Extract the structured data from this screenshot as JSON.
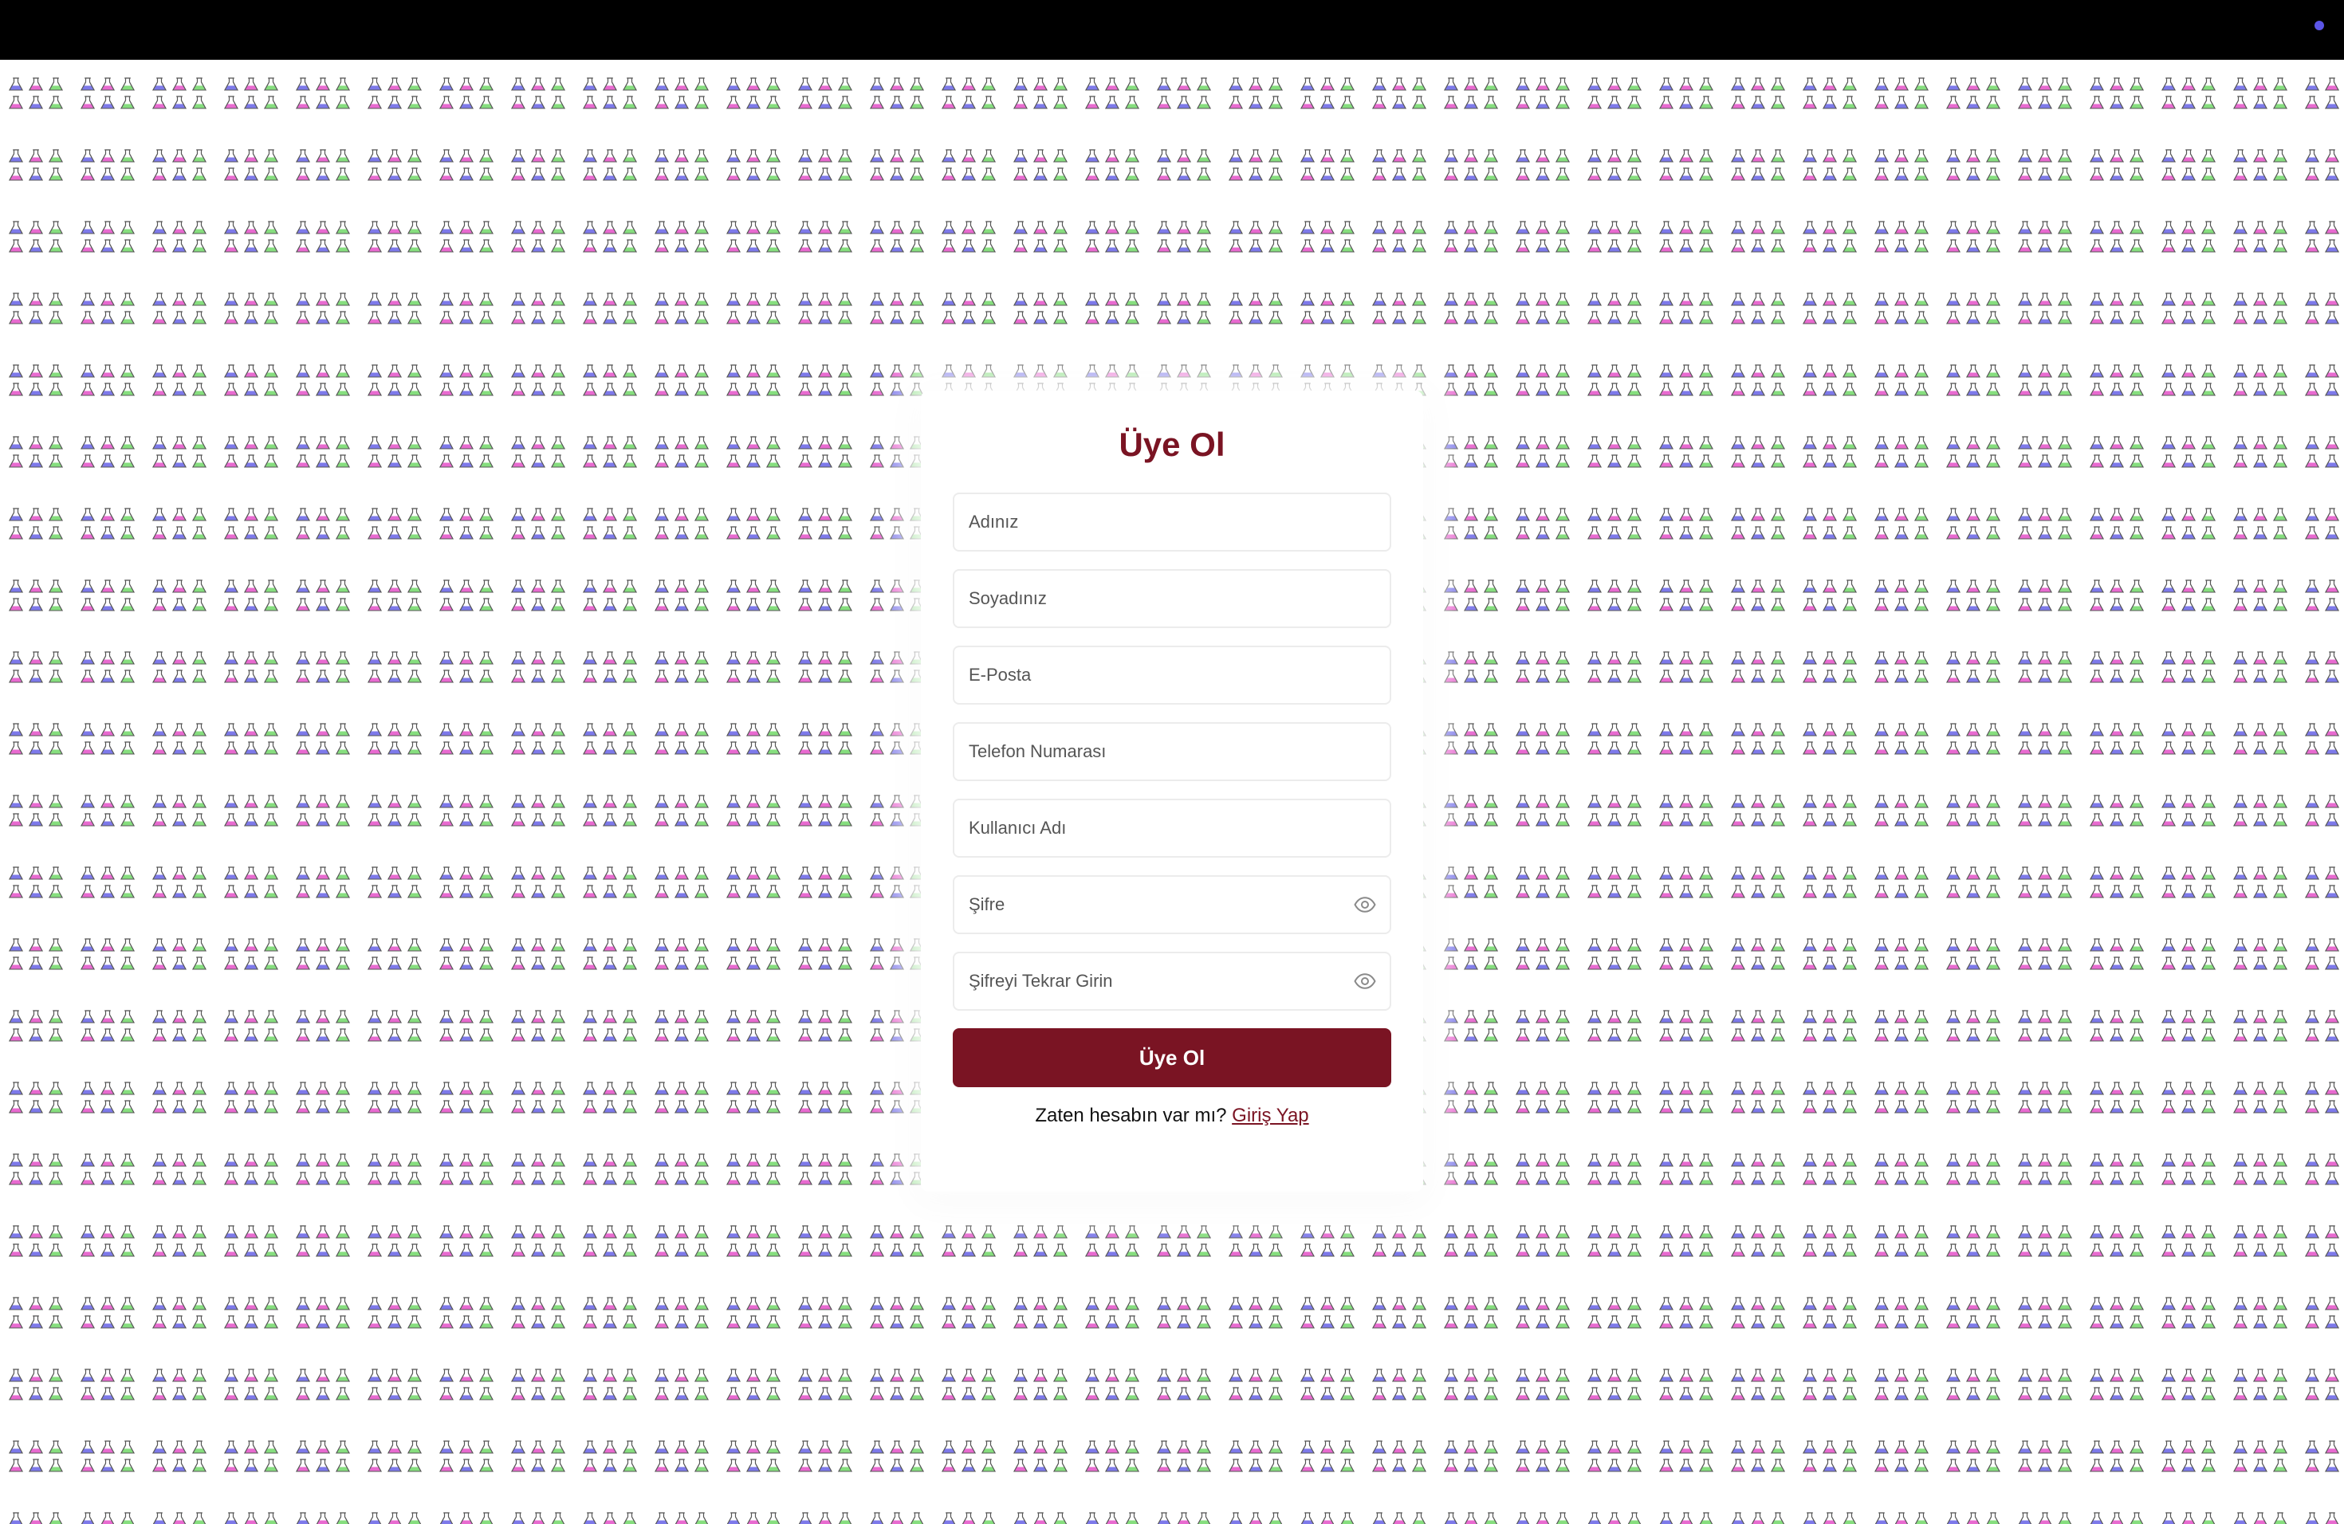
{
  "colors": {
    "brand": "#7a1423",
    "top_bar": "#000000",
    "status_dot": "#5b55e6",
    "flask_blue": "#7d79ea",
    "flask_pink": "#e86ad0",
    "flask_green": "#86de7e",
    "flask_outline": "#555555"
  },
  "background": {
    "icon": "flask-icon"
  },
  "form": {
    "title": "Üye Ol",
    "fields": {
      "first_name": {
        "placeholder": "Adınız"
      },
      "last_name": {
        "placeholder": "Soyadınız"
      },
      "email": {
        "placeholder": "E-Posta"
      },
      "phone": {
        "placeholder": "Telefon Numarası"
      },
      "username": {
        "placeholder": "Kullanıcı Adı"
      },
      "password": {
        "placeholder": "Şifre",
        "toggle_icon": "eye-icon"
      },
      "password_confirm": {
        "placeholder": "Şifreyi Tekrar Girin",
        "toggle_icon": "eye-icon"
      }
    },
    "submit_label": "Üye Ol",
    "footer_text": "Zaten hesabın var mı?",
    "login_link": "Giriş Yap"
  }
}
